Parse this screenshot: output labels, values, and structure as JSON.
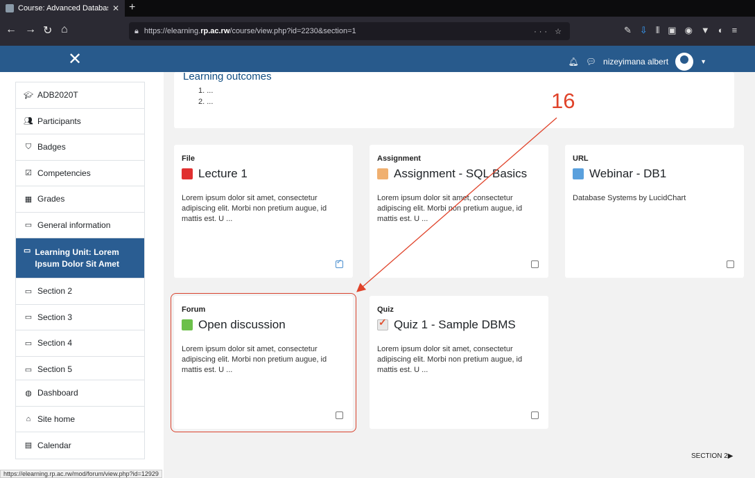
{
  "browser": {
    "tab_title": "Course: Advanced Database Sy",
    "url_prefix": "https://elearning.",
    "url_domain": "rp.ac.rw",
    "url_path": "/course/view.php?id=2230&section=1",
    "status_url": "https://elearning.rp.ac.rw/mod/forum/view.php?id=12929"
  },
  "header": {
    "user_name": "nizeyimana albert"
  },
  "drawer": {
    "items": [
      {
        "label": "ADB2020T",
        "icon": "graduation-cap-icon"
      },
      {
        "label": "Participants",
        "icon": "users-icon"
      },
      {
        "label": "Badges",
        "icon": "shield-icon"
      },
      {
        "label": "Competencies",
        "icon": "checkbox-icon"
      },
      {
        "label": "Grades",
        "icon": "table-icon"
      },
      {
        "label": "General information",
        "icon": "folder-icon"
      },
      {
        "label": "Learning Unit: Lorem Ipsum Dolor Sit Amet",
        "icon": "folder-icon",
        "active": true
      },
      {
        "label": "Section 2",
        "icon": "folder-icon"
      },
      {
        "label": "Section 3",
        "icon": "folder-icon"
      },
      {
        "label": "Section 4",
        "icon": "folder-icon"
      },
      {
        "label": "Section 5",
        "icon": "folder-icon"
      }
    ],
    "items2": [
      {
        "label": "Dashboard",
        "icon": "dashboard-icon"
      },
      {
        "label": "Site home",
        "icon": "home-icon"
      },
      {
        "label": "Calendar",
        "icon": "calendar-icon"
      }
    ]
  },
  "outcomes": {
    "title": "Learning outcomes",
    "items": [
      "1. ...",
      "2. ..."
    ]
  },
  "cards": [
    {
      "type": "File",
      "name": "Lecture 1",
      "desc": "Lorem ipsum dolor sit amet, consectetur adipiscing elit. Morbi non pretium augue, id mattis est. U ...",
      "done": true
    },
    {
      "type": "Assignment",
      "name": "Assignment - SQL Basics",
      "desc": "Lorem ipsum dolor sit amet, consectetur adipiscing elit. Morbi non pretium augue, id mattis est. U ...",
      "done": false
    },
    {
      "type": "URL",
      "name": "Webinar - DB1",
      "desc": "Database Systems by LucidChart",
      "done": false
    },
    {
      "type": "Forum",
      "name": "Open discussion",
      "desc": "Lorem ipsum dolor sit amet, consectetur adipiscing elit. Morbi non pretium augue, id mattis est. U ...",
      "done": false
    },
    {
      "type": "Quiz",
      "name": "Quiz 1 - Sample DBMS",
      "desc": "Lorem ipsum dolor sit amet, consectetur adipiscing elit. Morbi non pretium augue, id mattis est. U ...",
      "done": false
    }
  ],
  "annotation": {
    "number": "16"
  },
  "footer": {
    "next_section": "SECTION 2▶"
  }
}
